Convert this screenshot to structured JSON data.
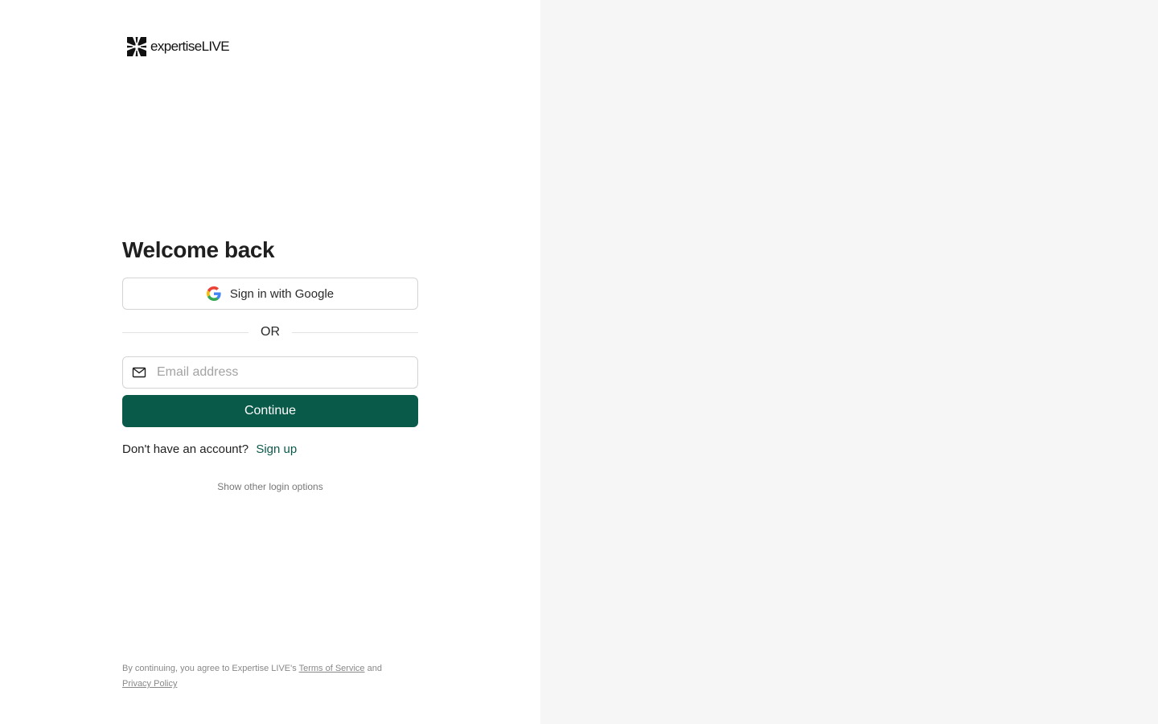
{
  "brand": {
    "logo_icon": "expertise-live-logo-icon",
    "name": "expertiseLIVE"
  },
  "login": {
    "title": "Welcome back",
    "google_button_label": "Sign in with Google",
    "google_icon": "google-g-icon",
    "divider_text": "OR",
    "email_placeholder": "Email address",
    "email_value": "",
    "email_icon": "mail-icon",
    "continue_label": "Continue",
    "signup_prompt": "Don't have an account?",
    "signup_link": "Sign up",
    "other_options": "Show other login options"
  },
  "legal": {
    "prefix": "By continuing, you agree to Expertise LIVE's",
    "terms_link": "Terms of Service",
    "conjunction": "and",
    "privacy_link": "Privacy Policy"
  },
  "colors": {
    "accent": "#0a5a4a",
    "right_panel_background": "#f6f6f6",
    "border": "#d4d4d4",
    "muted_text": "#888888"
  }
}
